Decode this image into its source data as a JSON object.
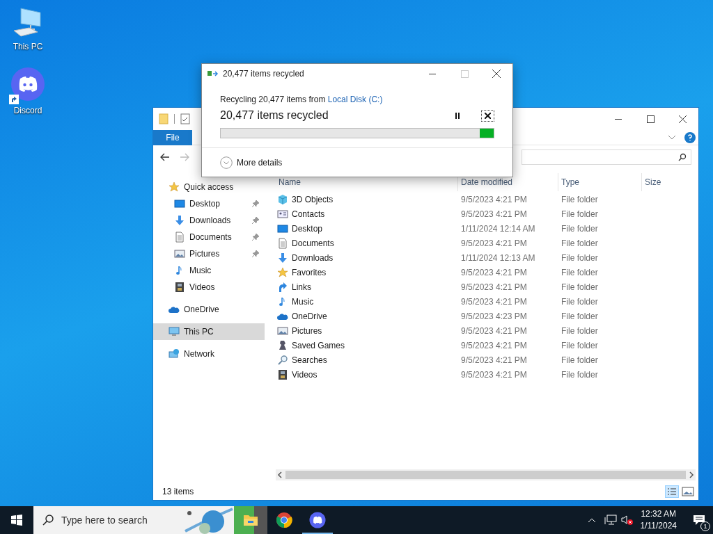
{
  "desktop_icons": [
    {
      "label": "This PC",
      "kind": "pc"
    },
    {
      "label": "Discord",
      "kind": "discord"
    }
  ],
  "explorer": {
    "file_tab": "File",
    "nav": [
      {
        "label": "Quick access",
        "kind": "star",
        "selected": false,
        "children": [
          {
            "label": "Desktop",
            "kind": "desktop",
            "pinned": true,
            "selected": false
          },
          {
            "label": "Downloads",
            "kind": "download",
            "pinned": true,
            "selected": false
          },
          {
            "label": "Documents",
            "kind": "document",
            "pinned": true,
            "selected": false
          },
          {
            "label": "Pictures",
            "kind": "picture",
            "pinned": true,
            "selected": false
          },
          {
            "label": "Music",
            "kind": "music",
            "pinned": false,
            "selected": false
          },
          {
            "label": "Videos",
            "kind": "video",
            "pinned": false,
            "selected": false
          }
        ]
      },
      {
        "label": "OneDrive",
        "kind": "cloud",
        "selected": false
      },
      {
        "label": "This PC",
        "kind": "pc",
        "selected": true
      },
      {
        "label": "Network",
        "kind": "network",
        "selected": false
      }
    ],
    "columns": [
      "Name",
      "Date modified",
      "Type",
      "Size"
    ],
    "rows": [
      {
        "name": "3D Objects",
        "kind": "cube",
        "date": "9/5/2023 4:21 PM",
        "type": "File folder"
      },
      {
        "name": "Contacts",
        "kind": "contact",
        "date": "9/5/2023 4:21 PM",
        "type": "File folder"
      },
      {
        "name": "Desktop",
        "kind": "desktop",
        "date": "1/11/2024 12:14 AM",
        "type": "File folder"
      },
      {
        "name": "Documents",
        "kind": "document",
        "date": "9/5/2023 4:21 PM",
        "type": "File folder"
      },
      {
        "name": "Downloads",
        "kind": "download",
        "date": "1/11/2024 12:13 AM",
        "type": "File folder"
      },
      {
        "name": "Favorites",
        "kind": "star",
        "date": "9/5/2023 4:21 PM",
        "type": "File folder"
      },
      {
        "name": "Links",
        "kind": "link",
        "date": "9/5/2023 4:21 PM",
        "type": "File folder"
      },
      {
        "name": "Music",
        "kind": "music",
        "date": "9/5/2023 4:21 PM",
        "type": "File folder"
      },
      {
        "name": "OneDrive",
        "kind": "cloud",
        "date": "9/5/2023 4:23 PM",
        "type": "File folder"
      },
      {
        "name": "Pictures",
        "kind": "picture",
        "date": "9/5/2023 4:21 PM",
        "type": "File folder"
      },
      {
        "name": "Saved Games",
        "kind": "game",
        "date": "9/5/2023 4:21 PM",
        "type": "File folder"
      },
      {
        "name": "Searches",
        "kind": "search",
        "date": "9/5/2023 4:21 PM",
        "type": "File folder"
      },
      {
        "name": "Videos",
        "kind": "video",
        "date": "9/5/2023 4:21 PM",
        "type": "File folder"
      }
    ],
    "status": "13 items"
  },
  "dialog": {
    "title": "20,477 items recycled",
    "message": "Recycling 20,477 items from ",
    "link": "Local Disk (C:)",
    "progress_text": "20,477 items recycled",
    "level": 0.05,
    "more": "More details"
  },
  "taskbar": {
    "search_placeholder": "Type here to search",
    "apps": [
      {
        "kind": "explorer",
        "selected": true,
        "running": false
      },
      {
        "kind": "chrome",
        "selected": false,
        "running": false
      },
      {
        "kind": "discord",
        "selected": false,
        "running": true
      }
    ],
    "time": "12:32 AM",
    "date": "1/11/2024",
    "notifications": "1"
  }
}
